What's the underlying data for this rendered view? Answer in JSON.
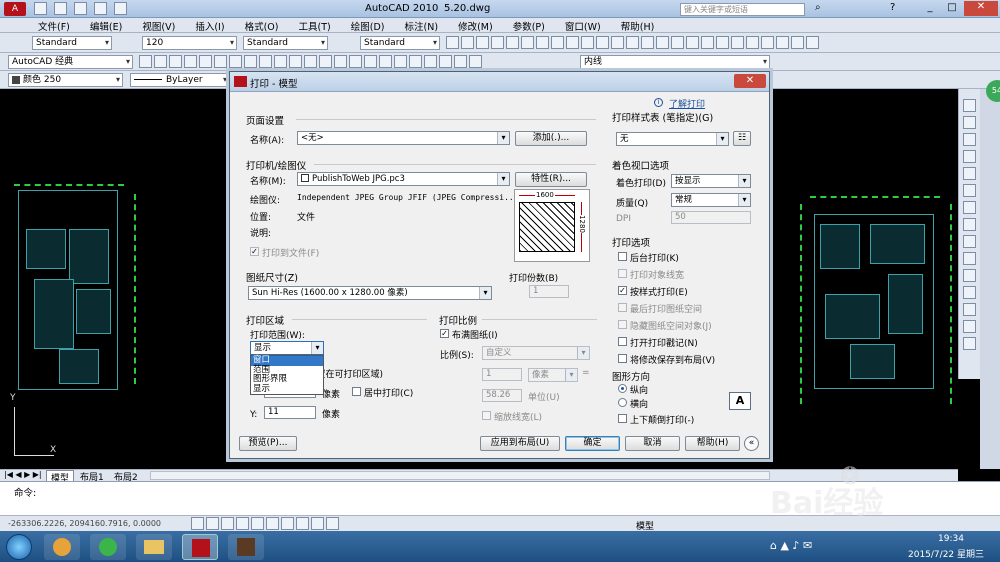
{
  "titlebar": {
    "app": "AutoCAD 2010",
    "file": "5.20.dwg",
    "search_placeholder": "键入关键字或短语"
  },
  "menu": [
    "文件(F)",
    "编辑(E)",
    "视图(V)",
    "插入(I)",
    "格式(O)",
    "工具(T)",
    "绘图(D)",
    "标注(N)",
    "修改(M)",
    "参数(P)",
    "窗口(W)",
    "帮助(H)"
  ],
  "toolbar1": {
    "text_style": "Standard",
    "text_height": "120",
    "dim_style": "Standard",
    "table_style": "Standard"
  },
  "toolbar2": {
    "workspace": "AutoCAD 经典",
    "linetype": "内线"
  },
  "toolbar3": {
    "color": "颜色 250",
    "layer": "ByLayer"
  },
  "layout_tabs": [
    "模型",
    "布局1",
    "布局2"
  ],
  "command": {
    "prompt": "命令:",
    "coords": "-263306.2226, 2094160.7916, 0.0000"
  },
  "status_model": "模型",
  "watermark": {
    "brand": "Bai经验",
    "url": "jingyan.baidu.com"
  },
  "dialog": {
    "title": "打印 - 模型",
    "help_link": "了解打印",
    "page_setup": {
      "section": "页面设置",
      "name_label": "名称(A):",
      "name_value": "<无>",
      "add_button": "添加(.)..."
    },
    "printer": {
      "section": "打印机/绘图仪",
      "name_label": "名称(M):",
      "name_value": "PublishToWeb JPG.pc3",
      "props_button": "特性(R)...",
      "plotter_label": "绘图仪:",
      "plotter_value": "Independent JPEG Group JFIF (JPEG Compressi...",
      "where_label": "位置:",
      "where_value": "文件",
      "desc_label": "说明:",
      "plot_to_file": "打印到文件(F)",
      "preview_w": "1600",
      "preview_h": "1280"
    },
    "paper": {
      "section": "图纸尺寸(Z)",
      "value": "Sun Hi-Res (1600.00 x 1280.00 像素)"
    },
    "copies": {
      "label": "打印份数(B)",
      "value": "1"
    },
    "area": {
      "section": "打印区域",
      "range_label": "打印范围(W):",
      "range_value": "显示",
      "options": [
        "窗口",
        "范围",
        "图形界限",
        "显示"
      ]
    },
    "offset": {
      "label": "打印偏移(原点设置在可打印区域)",
      "x_label": "X:",
      "x_value": "10",
      "y_label": "Y:",
      "y_value": "11",
      "unit": "像素",
      "center": "居中打印(C)"
    },
    "scale": {
      "section": "打印比例",
      "fit": "布满图纸(I)",
      "scale_label": "比例(S):",
      "scale_value": "自定义",
      "val1": "1",
      "unit1": "像素",
      "val2": "58.26",
      "unit2": "单位(U)",
      "lineweight": "缩放线宽(L)"
    },
    "style_table": {
      "section": "打印样式表 (笔指定)(G)",
      "value": "无"
    },
    "shaded": {
      "section": "着色视口选项",
      "shade_label": "着色打印(D)",
      "shade_value": "按显示",
      "quality_label": "质量(Q)",
      "quality_value": "常规",
      "dpi_label": "DPI",
      "dpi_value": "50"
    },
    "options": {
      "section": "打印选项",
      "items": [
        {
          "label": "后台打印(K)",
          "checked": false,
          "enabled": true
        },
        {
          "label": "打印对象线宽",
          "checked": false,
          "enabled": false
        },
        {
          "label": "按样式打印(E)",
          "checked": true,
          "enabled": true
        },
        {
          "label": "最后打印图纸空间",
          "checked": false,
          "enabled": false
        },
        {
          "label": "隐藏图纸空间对象(J)",
          "checked": false,
          "enabled": false
        },
        {
          "label": "打开打印戳记(N)",
          "checked": false,
          "enabled": true
        },
        {
          "label": "将修改保存到布局(V)",
          "checked": false,
          "enabled": true
        }
      ]
    },
    "orientation": {
      "section": "图形方向",
      "portrait": "纵向",
      "landscape": "横向",
      "upside": "上下颠倒打印(-)"
    },
    "buttons": {
      "preview": "预览(P)...",
      "apply": "应用到布局(U)",
      "ok": "确定",
      "cancel": "取消",
      "help": "帮助(H)"
    }
  },
  "taskbar": {
    "time": "19:34",
    "date": "2015/7/22 星期三"
  }
}
